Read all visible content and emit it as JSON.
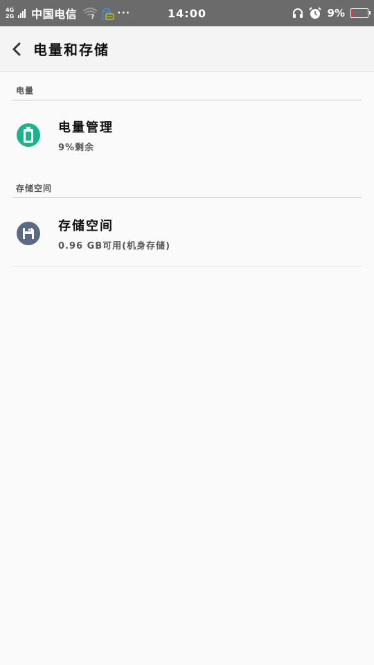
{
  "status_bar": {
    "net_type_top": "4G",
    "net_type_bottom": "2G",
    "carrier": "中国电信",
    "more": "···",
    "time": "14:00",
    "battery_percent": "9%",
    "battery_level": 0.09,
    "battery_color": "#e53935"
  },
  "header": {
    "title": "电量和存储"
  },
  "sections": [
    {
      "header": "电量",
      "items": [
        {
          "title": "电量管理",
          "subtitle": "9%剩余",
          "icon": "battery-icon",
          "icon_color": "#1bb28c"
        }
      ]
    },
    {
      "header": "存储空间",
      "items": [
        {
          "title": "存储空间",
          "subtitle": "0.96 GB可用(机身存储)",
          "icon": "floppy-disk-icon",
          "icon_color": "#5a6a85"
        }
      ]
    }
  ]
}
